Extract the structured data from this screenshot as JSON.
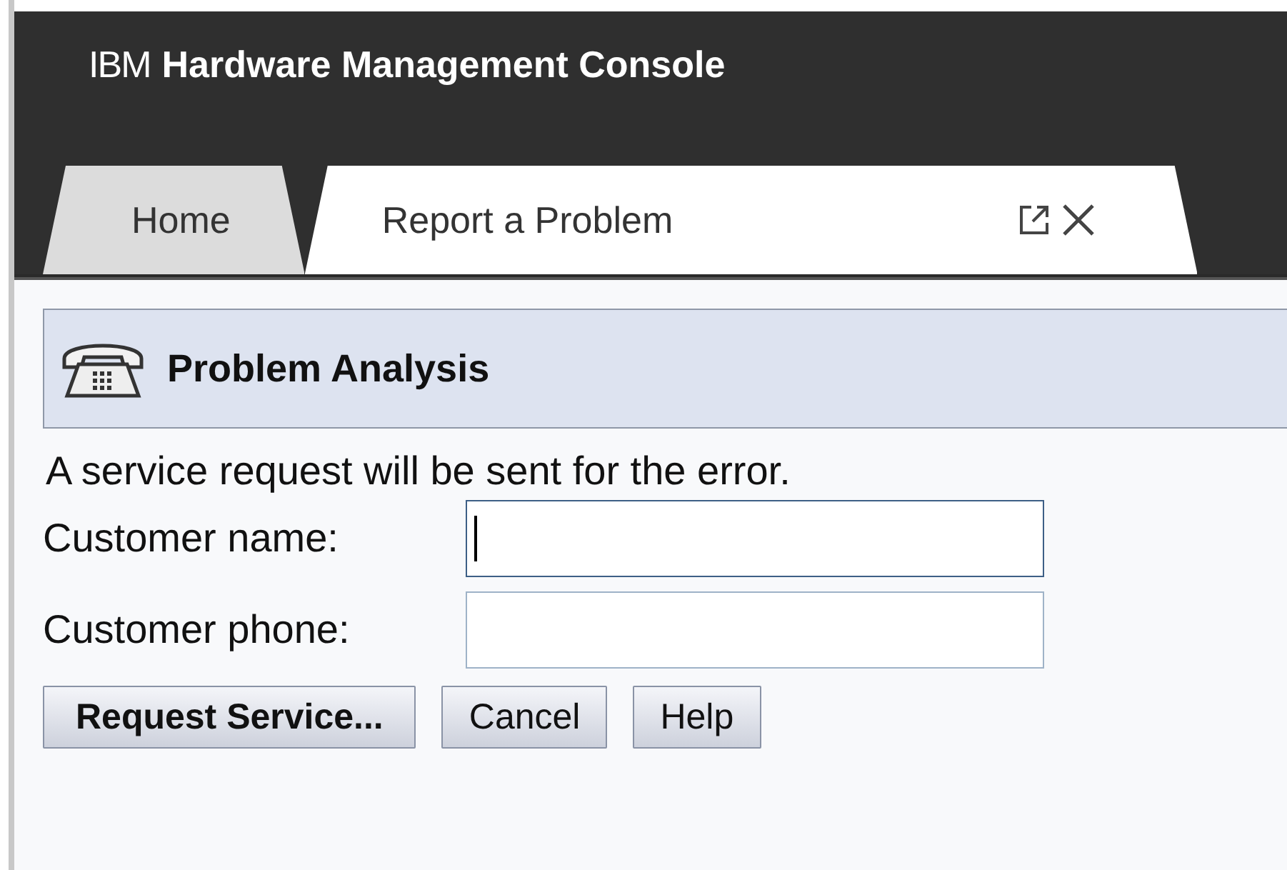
{
  "header": {
    "brand": "IBM",
    "title": "Hardware Management Console"
  },
  "tabs": [
    {
      "label": "Home",
      "selected": false
    },
    {
      "label": "Report a Problem",
      "selected": true
    }
  ],
  "section": {
    "title": "Problem Analysis"
  },
  "message": "A service request will be sent for the error.",
  "fields": [
    {
      "label": "Customer name:",
      "focused": true
    },
    {
      "label": "Customer phone:",
      "focused": false
    }
  ],
  "buttons": [
    {
      "label": "Request Service...",
      "default": true
    },
    {
      "label": "Cancel",
      "default": false
    },
    {
      "label": "Help",
      "default": false
    }
  ]
}
